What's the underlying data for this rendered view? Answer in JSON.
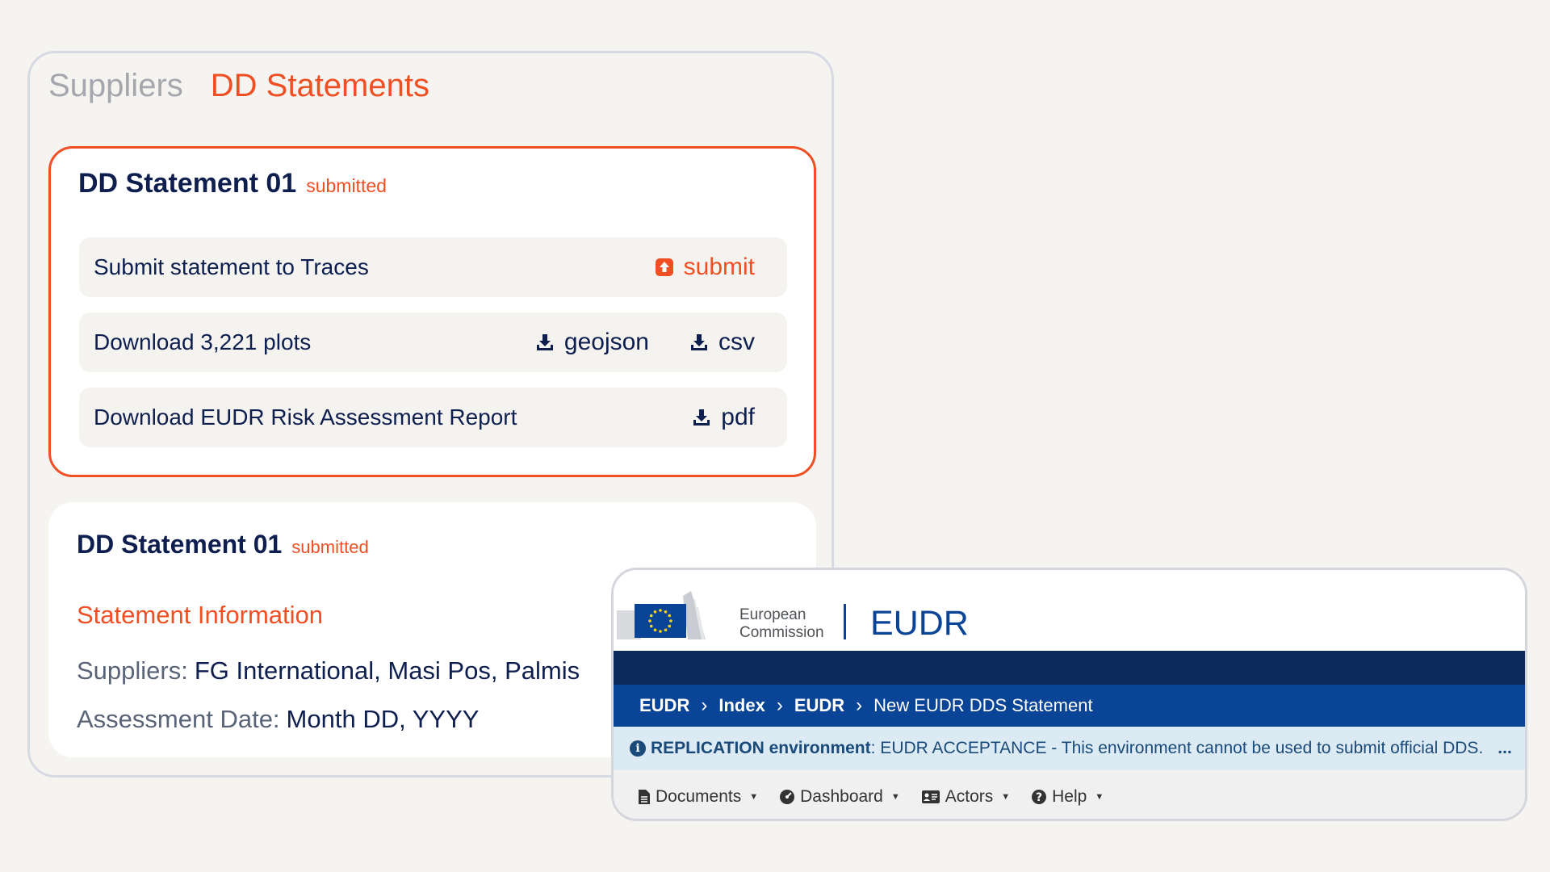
{
  "tabs": [
    {
      "label": "Suppliers",
      "active": false
    },
    {
      "label": "DD Statements",
      "active": true
    }
  ],
  "card1": {
    "title": "DD Statement 01",
    "status": "submitted",
    "rows": [
      {
        "label": "Submit statement to Traces",
        "actions": [
          {
            "label": "submit",
            "icon": "upload-icon"
          }
        ]
      },
      {
        "label": "Download 3,221 plots",
        "actions": [
          {
            "label": "geojson",
            "icon": "download-icon"
          },
          {
            "label": "csv",
            "icon": "download-icon"
          }
        ]
      },
      {
        "label": "Download EUDR Risk Assessment Report",
        "actions": [
          {
            "label": "pdf",
            "icon": "download-icon"
          }
        ]
      }
    ]
  },
  "card2": {
    "title": "DD Statement 01",
    "status": "submitted",
    "section": "Statement Information",
    "suppliers_label": "Suppliers:",
    "suppliers_value": "FG International, Masi Pos, Palmis",
    "date_label": "Assessment Date:",
    "date_value": "Month DD, YYYY"
  },
  "eudr": {
    "logo_line1": "European",
    "logo_line2": "Commission",
    "app_title": "EUDR",
    "breadcrumbs": [
      "EUDR",
      "Index",
      "EUDR",
      "New EUDR DDS Statement"
    ],
    "notice_strong": "REPLICATION environment",
    "notice_text": ": EUDR ACCEPTANCE - This environment cannot be used to submit official DDS.",
    "notice_more": "...",
    "menus": [
      {
        "label": "Documents",
        "icon": "document-icon"
      },
      {
        "label": "Dashboard",
        "icon": "dashboard-icon"
      },
      {
        "label": "Actors",
        "icon": "id-card-icon"
      },
      {
        "label": "Help",
        "icon": "help-icon"
      }
    ]
  },
  "colors": {
    "accent": "#f04e23",
    "navy": "#0e1f4f",
    "ec_blue": "#0a4496",
    "ec_dark": "#0b2a5b",
    "background": "#f5f4f1"
  }
}
